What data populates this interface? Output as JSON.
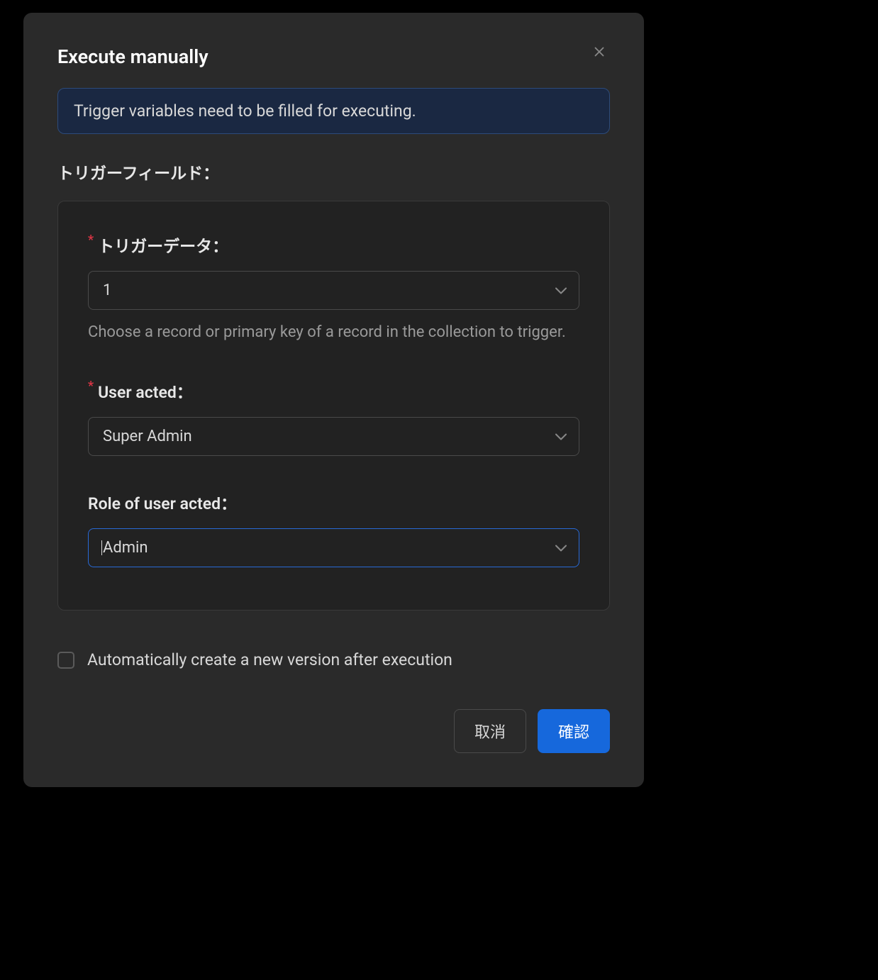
{
  "modal": {
    "title": "Execute manually",
    "alert_text": "Trigger variables need to be filled for executing.",
    "section_label": "トリガーフィールド：",
    "fields": {
      "trigger_data": {
        "label": "トリガーデータ：",
        "value": "1",
        "help": "Choose a record or primary key of a record in the collection to trigger.",
        "required": true
      },
      "user_acted": {
        "label": "User acted：",
        "value": "Super Admin",
        "required": true
      },
      "role_of_user": {
        "label": "Role of user acted：",
        "value": "Admin",
        "required": false
      }
    },
    "checkbox_label": "Automatically create a new version after execution",
    "buttons": {
      "cancel": "取消",
      "confirm": "確認"
    }
  }
}
